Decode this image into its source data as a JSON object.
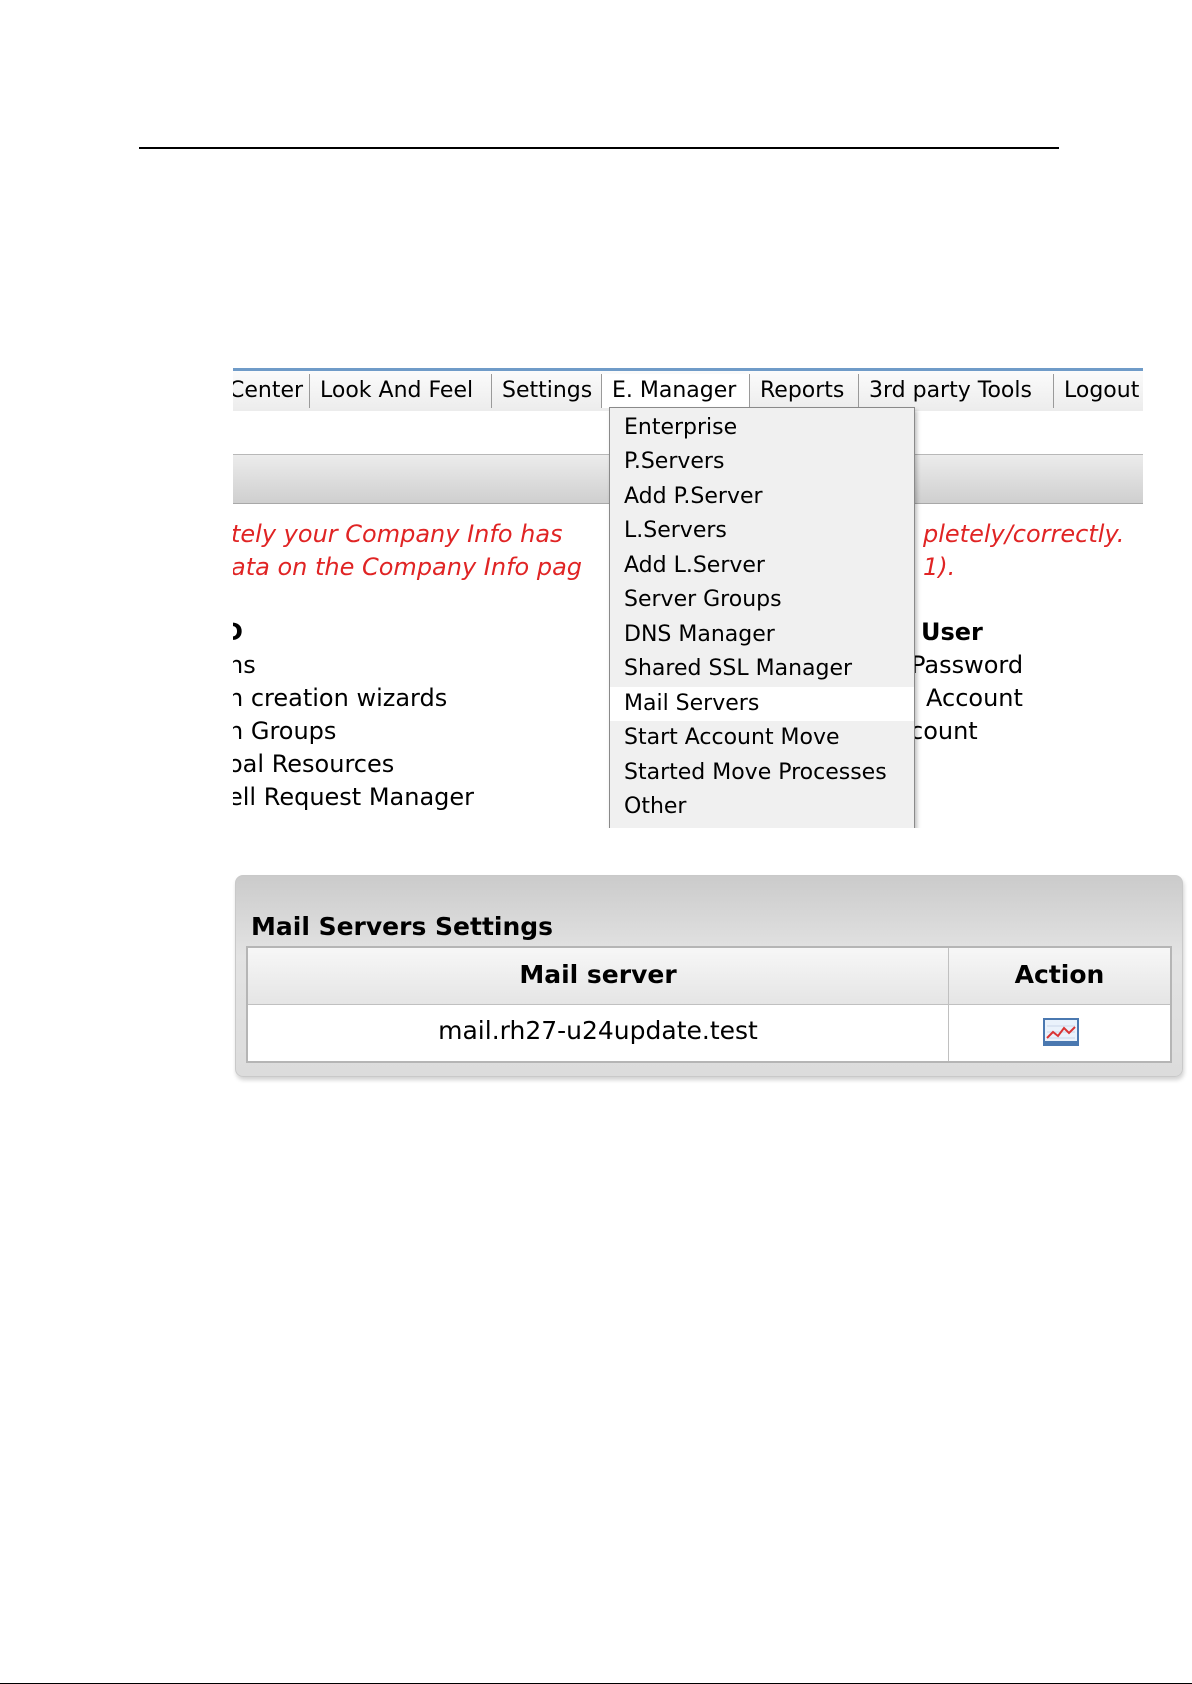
{
  "menubar": {
    "tabs": [
      {
        "label": "Center"
      },
      {
        "label": "Look And Feel"
      },
      {
        "label": "Settings"
      },
      {
        "label": "E. Manager"
      },
      {
        "label": "Reports"
      },
      {
        "label": "3rd party Tools"
      },
      {
        "label": "Logout"
      }
    ],
    "accent_color": "#6f9bc8"
  },
  "warning": {
    "line1_left": "tely your Company Info has",
    "line1_right": "pletely/correctly.",
    "line2_left": "ata on the Company Info pag",
    "line2_right": "1).",
    "color": "#e02424"
  },
  "left_column": {
    "heading": "D",
    "items": [
      "ns",
      "n creation wizards",
      "n Groups",
      "oal Resources",
      "ell Request Manager"
    ]
  },
  "right_column": {
    "heading": "User",
    "items": [
      "Password",
      "Account",
      "count"
    ]
  },
  "dropdown": {
    "items": [
      {
        "label": "Enterprise"
      },
      {
        "label": "P.Servers"
      },
      {
        "label": "Add P.Server"
      },
      {
        "label": "L.Servers"
      },
      {
        "label": "Add L.Server"
      },
      {
        "label": "Server Groups"
      },
      {
        "label": "DNS Manager"
      },
      {
        "label": "Shared SSL Manager"
      },
      {
        "label": "Mail Servers"
      },
      {
        "label": "Start Account Move"
      },
      {
        "label": "Started Move Processes"
      },
      {
        "label": "Other"
      }
    ],
    "highlighted": "Mail Servers"
  },
  "mail_settings": {
    "title": "Mail Servers Settings",
    "columns": [
      "Mail server",
      "Action"
    ],
    "rows": [
      {
        "server": "mail.rh27-u24update.test",
        "action_icon": "graph-icon"
      }
    ]
  }
}
